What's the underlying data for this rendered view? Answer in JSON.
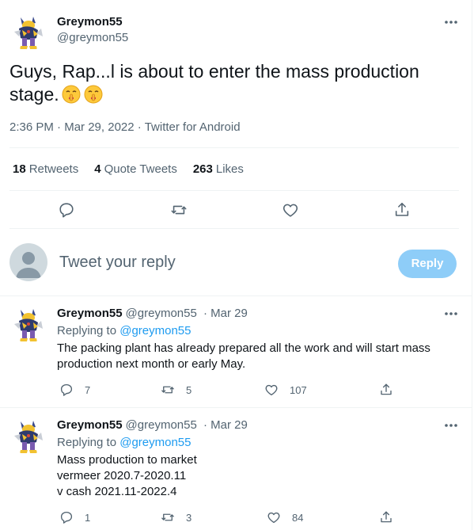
{
  "tweet": {
    "name": "Greymon55",
    "handle": "@greymon55",
    "text": "Guys, Rap...l is about to enter the mass production stage.",
    "emoji": [
      "shushing-face",
      "shushing-face"
    ],
    "time": "2:36 PM",
    "date": "Mar 29, 2022",
    "source": "Twitter for Android",
    "separator": "·",
    "stats": [
      {
        "count": "18",
        "label": "Retweets"
      },
      {
        "count": "4",
        "label": "Quote Tweets"
      },
      {
        "count": "263",
        "label": "Likes"
      }
    ],
    "actions": [
      "reply-icon",
      "retweet-icon",
      "like-icon",
      "share-icon"
    ]
  },
  "reply_box": {
    "placeholder": "Tweet your reply",
    "button": "Reply",
    "button_color": "#8ecdf8"
  },
  "replies": [
    {
      "name": "Greymon55",
      "handle": "@greymon55",
      "date": "Mar 29",
      "replying_label": "Replying to",
      "replying_to": "@greymon55",
      "lines": [
        "The packing plant has already prepared all the work and will start mass",
        "production next month or early May."
      ],
      "reply_count": "7",
      "retweet_count": "5",
      "like_count": "107"
    },
    {
      "name": "Greymon55",
      "handle": "@greymon55",
      "date": "Mar 29",
      "replying_label": "Replying to",
      "replying_to": "@greymon55",
      "lines": [
        "Mass production to market",
        "vermeer 2020.7-2020.11",
        "v cash 2021.11-2022.4"
      ],
      "reply_count": "1",
      "retweet_count": "3",
      "like_count": "84"
    }
  ],
  "colors": {
    "accent": "#1d9bf0",
    "text": "#0f1419",
    "muted": "#536471",
    "divider": "#eff3f4"
  }
}
